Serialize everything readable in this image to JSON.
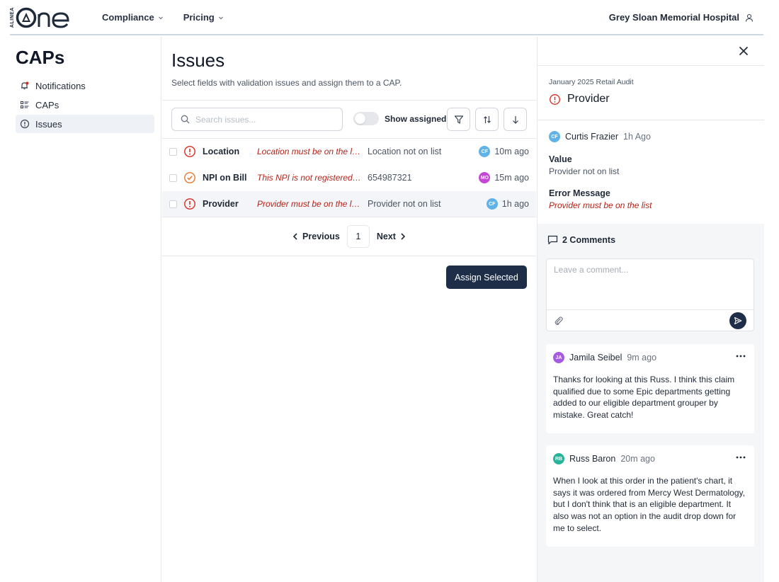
{
  "header": {
    "logo_small": "ALINEA",
    "logo_word": "one",
    "nav": [
      {
        "label": "Compliance"
      },
      {
        "label": "Pricing"
      }
    ],
    "org_name": "Grey Sloan Memorial Hospital"
  },
  "sidebar": {
    "title": "CAPs",
    "items": [
      {
        "label": "Notifications",
        "icon": "bell-icon"
      },
      {
        "label": "CAPs",
        "icon": "list-icon"
      },
      {
        "label": "Issues",
        "icon": "alert-circle-icon",
        "active": true
      }
    ]
  },
  "main": {
    "title": "Issues",
    "subtitle": "Select fields with validation issues and assign them to a CAP.",
    "search_placeholder": "Search issues...",
    "toggle_label": "Show assigned",
    "rows": [
      {
        "field": "Location",
        "error": "Location must be on the list.",
        "value": "Location not on list",
        "initials": "CF",
        "avatar_color": "#5fb3e8",
        "time": "10m ago",
        "status": "error"
      },
      {
        "field": "NPI on Bill",
        "error": "This NPI is not registered f...",
        "value": "654987321",
        "initials": "MO",
        "avatar_color": "#c447d6",
        "time": "15m ago",
        "status": "assigned"
      },
      {
        "field": "Provider",
        "error": "Provider must be on the list.",
        "value": "Provider not on list",
        "initials": "CF",
        "avatar_color": "#5fb3e8",
        "time": "1h ago",
        "status": "error"
      }
    ],
    "pager": {
      "prev": "Previous",
      "page": "1",
      "next": "Next"
    },
    "assign_label": "Assign Selected"
  },
  "panel": {
    "audit": "January 2025 Retail Audit",
    "title": "Provider",
    "user": {
      "initials": "CF",
      "name": "Curtis Frazier",
      "time": "1h Ago",
      "color": "#5fb3e8"
    },
    "value_label": "Value",
    "value": "Provider not on list",
    "error_label": "Error Message",
    "error": "Provider must be on the list",
    "comments_title": "2 Comments",
    "comment_placeholder": "Leave a comment...",
    "comments": [
      {
        "initials": "JA",
        "name": "Jamila Seibel",
        "time": "9m ago",
        "color": "#a55ce0",
        "text": "Thanks for looking at this Russ. I think this claim qualified due to some Epic departments getting added to our eligible department grouper by mistake. Great catch!"
      },
      {
        "initials": "RB",
        "name": "Russ Baron",
        "time": "20m ago",
        "color": "#26b39a",
        "text": "When I look at this order in the patient's chart, it says it was ordered from Mercy West Dermatology, but I don't think that is an eligible department. It also was not an option in the audit drop down for me to select."
      }
    ]
  },
  "colors": {
    "primary": "#1e2e49",
    "error": "#b42318",
    "warning": "#e8762b"
  }
}
